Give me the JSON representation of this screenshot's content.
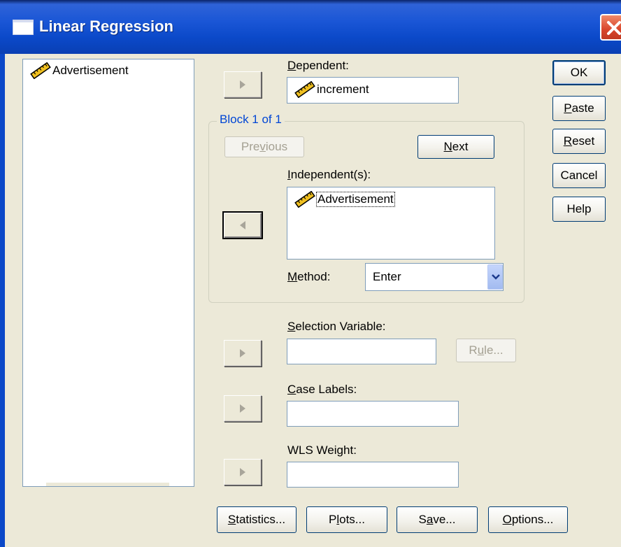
{
  "window": {
    "title": "Linear Regression",
    "close_icon": "close-icon",
    "app_icon": "window-icon"
  },
  "variable_list": {
    "items": [
      {
        "label": "Advertisement",
        "icon": "scale-ruler-icon"
      }
    ]
  },
  "dependent": {
    "label_pre": "",
    "label_hotkey": "D",
    "label_post": "ependent:",
    "value": "increment",
    "value_icon": "scale-ruler-icon"
  },
  "block": {
    "legend": "Block 1 of 1",
    "previous_pre": "Pre",
    "previous_hotkey": "v",
    "previous_post": "ious",
    "next_pre": "",
    "next_hotkey": "N",
    "next_post": "ext",
    "independents": {
      "label_pre": "",
      "label_hotkey": "I",
      "label_post": "ndependent(s):",
      "items": [
        {
          "label": "Advertisement",
          "icon": "scale-ruler-icon"
        }
      ]
    },
    "method": {
      "label_pre": "",
      "label_hotkey": "M",
      "label_post": "ethod:",
      "value": "Enter"
    }
  },
  "selection_variable": {
    "label_pre": "",
    "label_hotkey": "S",
    "label_post": "election Variable:",
    "value": "",
    "rule_pre": "R",
    "rule_hotkey": "u",
    "rule_post": "le..."
  },
  "case_labels": {
    "label_pre": "",
    "label_hotkey": "C",
    "label_post": "ase Labels:",
    "value": ""
  },
  "wls_weight": {
    "label_pre": "WLS Wei",
    "label_hotkey": "g",
    "label_post": "ht:",
    "value": ""
  },
  "side_buttons": {
    "ok": "OK",
    "paste_hotkey": "P",
    "paste_post": "aste",
    "reset_hotkey": "R",
    "reset_post": "eset",
    "cancel": "Cancel",
    "help": "Help"
  },
  "bottom_buttons": {
    "statistics_hotkey": "S",
    "statistics_post": "tatistics...",
    "plots_pre": "P",
    "plots_hotkey": "l",
    "plots_post": "ots...",
    "save_pre": "S",
    "save_hotkey": "a",
    "save_post": "ve...",
    "options_hotkey": "O",
    "options_post": "ptions..."
  },
  "colors": {
    "titlebar": "#0b49c9",
    "dialog_bg": "#ece9d8",
    "group_legend": "#0046d5",
    "disabled_text": "#a4a092"
  }
}
